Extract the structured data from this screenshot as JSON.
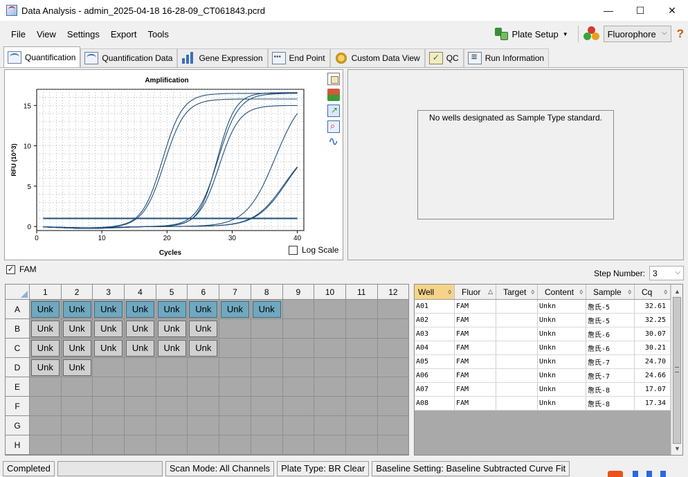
{
  "window": {
    "title": "Data Analysis - admin_2025-04-18 16-28-09_CT061843.pcrd",
    "minimize": "—",
    "maximize": "☐",
    "close": "✕"
  },
  "menu": {
    "items": [
      "File",
      "View",
      "Settings",
      "Export",
      "Tools"
    ],
    "plate_setup": "Plate Setup",
    "fluorophore": "Fluorophore",
    "help": "?"
  },
  "tabs": [
    {
      "label": "Quantification",
      "active": true,
      "icon": "amplification-icon"
    },
    {
      "label": "Quantification Data",
      "active": false,
      "icon": "data-sheet-icon"
    },
    {
      "label": "Gene Expression",
      "active": false,
      "icon": "bar-chart-icon"
    },
    {
      "label": "End Point",
      "active": false,
      "icon": "end-point-icon"
    },
    {
      "label": "Custom Data View",
      "active": false,
      "icon": "gear-icon"
    },
    {
      "label": "QC",
      "active": false,
      "icon": "qc-check-icon"
    },
    {
      "label": "Run Information",
      "active": false,
      "icon": "run-info-icon"
    }
  ],
  "chart_data": {
    "type": "line",
    "title": "Amplification",
    "xlabel": "Cycles",
    "ylabel": "RFU (10^3)",
    "xlim": [
      0,
      41
    ],
    "ylim": [
      -0.5,
      17
    ],
    "xticks": [
      0,
      10,
      20,
      30,
      40
    ],
    "yticks": [
      0,
      5,
      10,
      15
    ],
    "grid": true,
    "threshold": 1.0,
    "log_scale": false,
    "log_scale_label": "Log Scale",
    "line_color": "#1f4e79",
    "curves": [
      {
        "midpoint": 19.3,
        "slope": 1.55,
        "plateau": 16.5
      },
      {
        "midpoint": 19.6,
        "slope": 1.6,
        "plateau": 15.8
      },
      {
        "midpoint": 27.8,
        "slope": 1.6,
        "plateau": 16.5
      },
      {
        "midpoint": 28.0,
        "slope": 1.55,
        "plateau": 15.0
      },
      {
        "midpoint": 27.7,
        "slope": 1.4,
        "plateau": 16.6
      },
      {
        "midpoint": 36.6,
        "slope": 2.2,
        "plateau": 17.0
      },
      {
        "midpoint": 38.0,
        "slope": 2.3,
        "plateau": 10.5
      },
      {
        "midpoint": 38.3,
        "slope": 2.3,
        "plateau": 10.8
      }
    ]
  },
  "standard_panel": {
    "message": "No wells designated as Sample Type standard."
  },
  "fam": {
    "label": "FAM",
    "checked": "✓"
  },
  "step_number": {
    "label": "Step Number:",
    "value": "3"
  },
  "plate": {
    "columns": [
      "1",
      "2",
      "3",
      "4",
      "5",
      "6",
      "7",
      "8",
      "9",
      "10",
      "11",
      "12"
    ],
    "rows": [
      "A",
      "B",
      "C",
      "D",
      "E",
      "F",
      "G",
      "H"
    ],
    "well_label": "Unk",
    "wells": [
      {
        "row": 0,
        "col": 0,
        "selected": true
      },
      {
        "row": 0,
        "col": 1,
        "selected": true
      },
      {
        "row": 0,
        "col": 2,
        "selected": true
      },
      {
        "row": 0,
        "col": 3,
        "selected": true
      },
      {
        "row": 0,
        "col": 4,
        "selected": true
      },
      {
        "row": 0,
        "col": 5,
        "selected": true
      },
      {
        "row": 0,
        "col": 6,
        "selected": true
      },
      {
        "row": 0,
        "col": 7,
        "selected": true
      },
      {
        "row": 1,
        "col": 0,
        "selected": false
      },
      {
        "row": 1,
        "col": 1,
        "selected": false
      },
      {
        "row": 1,
        "col": 2,
        "selected": false
      },
      {
        "row": 1,
        "col": 3,
        "selected": false
      },
      {
        "row": 1,
        "col": 4,
        "selected": false
      },
      {
        "row": 1,
        "col": 5,
        "selected": false
      },
      {
        "row": 2,
        "col": 0,
        "selected": false
      },
      {
        "row": 2,
        "col": 1,
        "selected": false
      },
      {
        "row": 2,
        "col": 2,
        "selected": false
      },
      {
        "row": 2,
        "col": 3,
        "selected": false
      },
      {
        "row": 2,
        "col": 4,
        "selected": false
      },
      {
        "row": 2,
        "col": 5,
        "selected": false
      },
      {
        "row": 3,
        "col": 0,
        "selected": false
      },
      {
        "row": 3,
        "col": 1,
        "selected": false
      }
    ]
  },
  "results": {
    "headers": [
      {
        "label": "Well",
        "sort": "◊"
      },
      {
        "label": "Fluor",
        "sort": "△"
      },
      {
        "label": "Target",
        "sort": "◊"
      },
      {
        "label": "Content",
        "sort": "◊"
      },
      {
        "label": "Sample",
        "sort": "◊"
      },
      {
        "label": "Cq",
        "sort": "◊"
      }
    ],
    "rows": [
      {
        "well": "A01",
        "fluor": "FAM",
        "target": "",
        "content": "Unkn",
        "sample": "詹氏-5",
        "cq": "32.61"
      },
      {
        "well": "A02",
        "fluor": "FAM",
        "target": "",
        "content": "Unkn",
        "sample": "詹氏-5",
        "cq": "32.25"
      },
      {
        "well": "A03",
        "fluor": "FAM",
        "target": "",
        "content": "Unkn",
        "sample": "詹氏-6",
        "cq": "30.07"
      },
      {
        "well": "A04",
        "fluor": "FAM",
        "target": "",
        "content": "Unkn",
        "sample": "詹氏-6",
        "cq": "30.21"
      },
      {
        "well": "A05",
        "fluor": "FAM",
        "target": "",
        "content": "Unkn",
        "sample": "詹氏-7",
        "cq": "24.70"
      },
      {
        "well": "A06",
        "fluor": "FAM",
        "target": "",
        "content": "Unkn",
        "sample": "詹氏-7",
        "cq": "24.66"
      },
      {
        "well": "A07",
        "fluor": "FAM",
        "target": "",
        "content": "Unkn",
        "sample": "詹氏-8",
        "cq": "17.07"
      },
      {
        "well": "A08",
        "fluor": "FAM",
        "target": "",
        "content": "Unkn",
        "sample": "詹氏-8",
        "cq": "17.34"
      }
    ]
  },
  "status": {
    "state": "Completed",
    "scan_mode": "Scan Mode: All Channels",
    "plate_type": "Plate Type: BR Clear",
    "baseline": "Baseline Setting: Baseline Subtracted Curve Fit"
  },
  "colors": {
    "selected_well": "#6fa8bf",
    "unselected_well": "#d0d0d0",
    "empty_well": "#a9a9a9",
    "curve": "#1f4e79"
  }
}
